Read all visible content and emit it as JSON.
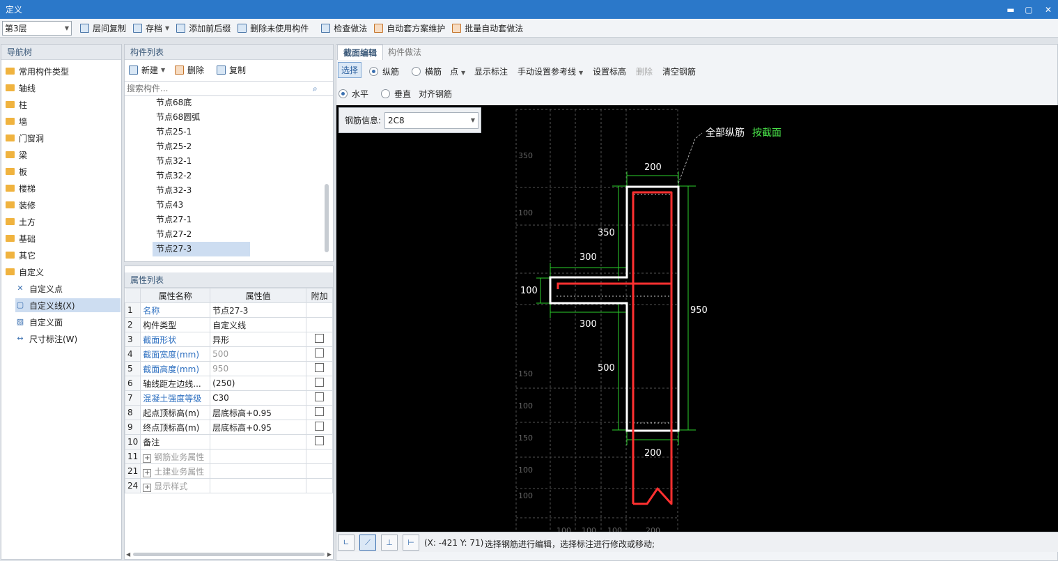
{
  "window": {
    "title": "定义",
    "min": "▬",
    "max": "▢",
    "close": "✕"
  },
  "toolbar": {
    "floor": "第3层",
    "items": [
      "层间复制",
      "存档",
      "添加前后缀",
      "删除未使用构件",
      "检查做法",
      "自动套方案维护",
      "批量自动套做法"
    ]
  },
  "nav": {
    "title": "导航树",
    "folders": [
      "常用构件类型",
      "轴线",
      "柱",
      "墙",
      "门窗洞",
      "梁",
      "板",
      "楼梯",
      "装修",
      "土方",
      "基础",
      "其它",
      "自定义"
    ],
    "custom": [
      "自定义点",
      "自定义线(X)",
      "自定义面",
      "尺寸标注(W)"
    ]
  },
  "list": {
    "title": "构件列表",
    "new": "新建",
    "delete": "删除",
    "copy": "复制",
    "search_placeholder": "搜索构件...",
    "items": [
      "节点68底",
      "节点68圆弧",
      "节点25-1",
      "节点25-2",
      "节点32-1",
      "节点32-2",
      "节点32-3",
      "节点43",
      "节点27-1",
      "节点27-2",
      "节点27-3"
    ]
  },
  "props": {
    "title": "属性列表",
    "headers": [
      "属性名称",
      "属性值",
      "附加"
    ],
    "rows": [
      {
        "no": "1",
        "name": "名称",
        "value": "节点27-3"
      },
      {
        "no": "2",
        "name": "构件类型",
        "value": "自定义线"
      },
      {
        "no": "3",
        "name": "截面形状",
        "value": "异形"
      },
      {
        "no": "4",
        "name": "截面宽度(mm)",
        "value": "500"
      },
      {
        "no": "5",
        "name": "截面高度(mm)",
        "value": "950"
      },
      {
        "no": "6",
        "name": "轴线距左边线...",
        "value": "(250)"
      },
      {
        "no": "7",
        "name": "混凝土强度等级",
        "value": "C30"
      },
      {
        "no": "8",
        "name": "起点顶标高(m)",
        "value": "层底标高+0.95"
      },
      {
        "no": "9",
        "name": "终点顶标高(m)",
        "value": "层底标高+0.95"
      },
      {
        "no": "10",
        "name": "备注",
        "value": ""
      },
      {
        "no": "11",
        "name": "钢筋业务属性",
        "value": ""
      },
      {
        "no": "21",
        "name": "土建业务属性",
        "value": ""
      },
      {
        "no": "24",
        "name": "显示样式",
        "value": ""
      }
    ]
  },
  "tabs": [
    "截面编辑",
    "构件做法"
  ],
  "edit": {
    "select": "选择",
    "long_bar": "纵筋",
    "tran_bar": "横筋",
    "point": "点",
    "show_label": "显示标注",
    "manual_ref": "手动设置参考线",
    "set_elev": "设置标高",
    "delete": "删除",
    "clear": "清空钢筋",
    "horizontal": "水平",
    "vertical": "垂直",
    "align": "对齐钢筋"
  },
  "rebar_info": {
    "label": "钢筋信息:",
    "value": "2C8"
  },
  "canvas": {
    "note_a": "全部纵筋",
    "note_b": "按截面",
    "dims": {
      "top": "200",
      "d350": "350",
      "d300a": "300",
      "d100": "100",
      "d950": "950",
      "d300b": "300",
      "d500": "500",
      "bottom": "200"
    },
    "grid_left": [
      "350",
      "100",
      "150",
      "100",
      "150",
      "100",
      "100"
    ],
    "grid_bottom": [
      "100",
      "100",
      "100",
      "200"
    ]
  },
  "status": {
    "coords": "(X: -421 Y: 71)",
    "message": "选择钢筋进行编辑，选择标注进行修改或移动;"
  }
}
